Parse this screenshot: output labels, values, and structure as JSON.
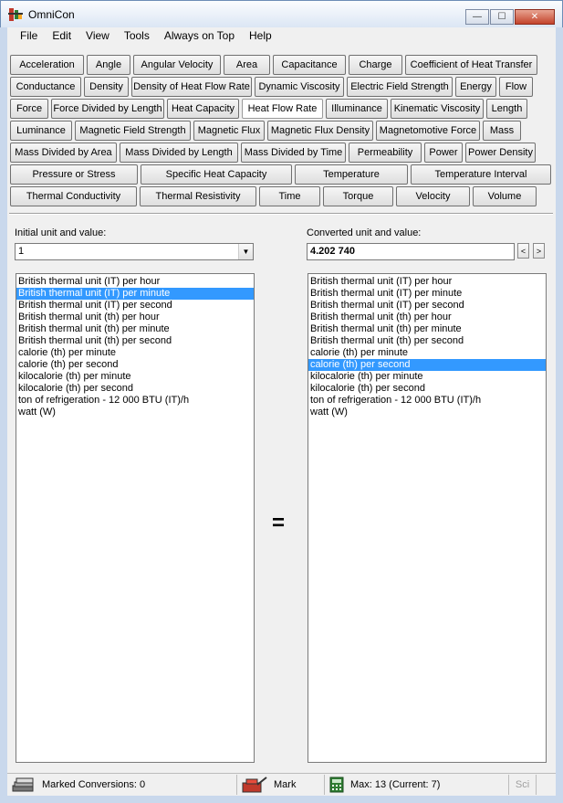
{
  "window": {
    "title": "OmniCon",
    "minimize_glyph": "—",
    "maximize_glyph": "☐",
    "close_glyph": "✕"
  },
  "menu": [
    "File",
    "Edit",
    "View",
    "Tools",
    "Always on Top",
    "Help"
  ],
  "categories": [
    [
      "Acceleration",
      "Angle",
      "Angular Velocity",
      "Area",
      "Capacitance",
      "Charge",
      "Coefficient of Heat Transfer"
    ],
    [
      "Conductance",
      "Density",
      "Density of Heat Flow Rate",
      "Dynamic Viscosity",
      "Electric Field Strength",
      "Energy",
      "Flow"
    ],
    [
      "Force",
      "Force Divided by Length",
      "Heat Capacity",
      "Heat Flow Rate",
      "Illuminance",
      "Kinematic Viscosity",
      "Length"
    ],
    [
      "Luminance",
      "Magnetic Field Strength",
      "Magnetic Flux",
      "Magnetic Flux Density",
      "Magnetomotive Force",
      "Mass"
    ],
    [
      "Mass Divided by Area",
      "Mass Divided by Length",
      "Mass Divided by Time",
      "Permeability",
      "Power",
      "Power Density"
    ],
    [
      "Pressure or Stress",
      "Specific Heat Capacity",
      "Temperature",
      "Temperature Interval"
    ],
    [
      "Thermal Conductivity",
      "Thermal Resistivity",
      "Time",
      "Torque",
      "Velocity",
      "Volume"
    ]
  ],
  "active_category": "Heat Flow Rate",
  "initial": {
    "label": "Initial unit and value:",
    "value": "1",
    "dropdown_glyph": "▼"
  },
  "converted": {
    "label": "Converted unit and value:",
    "value": "4.202 740",
    "prev_glyph": "<",
    "next_glyph": ">"
  },
  "equals": "=",
  "units": [
    "British thermal unit (IT) per hour",
    "British thermal unit (IT) per minute",
    "British thermal unit (IT) per second",
    "British thermal unit (th) per hour",
    "British thermal unit (th) per minute",
    "British thermal unit (th) per second",
    "calorie (th) per minute",
    "calorie (th) per second",
    "kilocalorie (th) per minute",
    "kilocalorie (th) per second",
    "ton of refrigeration - 12 000 BTU (IT)/h",
    "watt (W)"
  ],
  "left_selected": "British thermal unit (IT) per minute",
  "right_selected": "calorie (th) per second",
  "status": {
    "marked": "Marked Conversions: 0",
    "mark": "Mark",
    "max": "Max: 13 (Current: 7)",
    "sci": "Sci"
  },
  "colors": {
    "selection": "#3399ff",
    "title_gradient_top": "#fbfcfe",
    "close_button": "#c3432b"
  }
}
